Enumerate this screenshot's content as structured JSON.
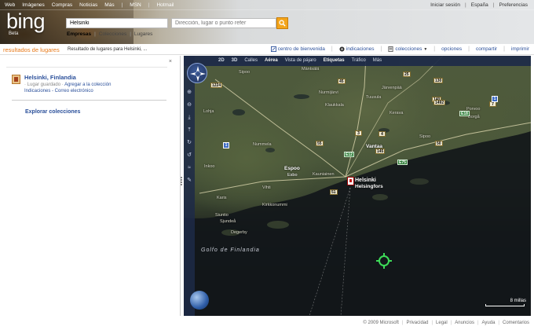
{
  "topnav": {
    "left": [
      "Web",
      "Imágenes",
      "Compras",
      "Noticias",
      "Más",
      "MSN",
      "Hotmail"
    ],
    "right": [
      "Iniciar sesión",
      "España",
      "Preferencias"
    ]
  },
  "logo": {
    "text": "bing",
    "badge": "Beta"
  },
  "search": {
    "query": "Helsinki",
    "location_placeholder": "Dirección, lugar o punto refer"
  },
  "category_tabs": [
    "Empresas",
    "Colecciones",
    "Lugares"
  ],
  "toolbar": {
    "results_title": "resultados de lugares",
    "results_sub": "Resultado de lugares para Helsinki, ...",
    "actions": [
      "centro de bienvenida",
      "indicaciones",
      "colecciones",
      "opciones",
      "compartir",
      "imprimir"
    ]
  },
  "left_panel": {
    "close": "×",
    "place": {
      "name": "Helsinki, Finlandia",
      "saved": "Lugar guardado",
      "add_link": "Agregar a la colección",
      "links": "Indicaciones - Correo electrónico"
    },
    "explore": "Explorar colecciones"
  },
  "map": {
    "view_tabs": [
      "2D",
      "3D",
      "Calles",
      "Aérea",
      "Vista de pájaro",
      "Etiquetas",
      "Tráfico",
      "Más"
    ],
    "active_tab": "Aérea",
    "scale": "8 millas",
    "cities": {
      "espoo": "Espoo",
      "espoo_sv": "Esbo",
      "vantaa": "Vantaa",
      "helsinki": "Helsinki",
      "helsinki_sv": "Helsingfors"
    },
    "water": "Golfo de Finlandia",
    "places": [
      "Nummela",
      "Vihti",
      "Kirkkonummi",
      "Kauniainen",
      "Järvenpää",
      "Kerava",
      "Porvoo",
      "Tuusula",
      "Nurmijärvi",
      "Hyvinkää",
      "Sipoo",
      "Mäntsälä",
      "Lohja",
      "Inkoo",
      "Siuntio",
      "Degerby",
      "Sjundeå",
      "Karis",
      "Klaukkala",
      "Borgå"
    ],
    "routes": [
      "1224",
      "45",
      "25",
      "3",
      "4",
      "7",
      "55",
      "130",
      "140",
      "145",
      "1492",
      "1",
      "E18",
      "E12",
      "E75",
      "51",
      "50"
    ]
  },
  "footer": [
    "© 2009 Microsoft",
    "Privacidad",
    "Legal",
    "Anuncios",
    "Ayuda",
    "Comentarios"
  ]
}
